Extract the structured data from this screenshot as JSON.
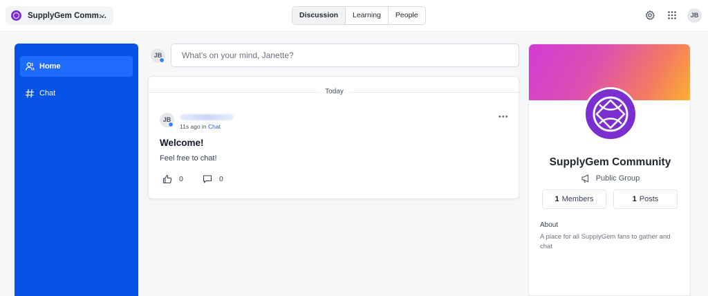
{
  "topbar": {
    "community_name": "SupplyGem Comm…",
    "tabs": [
      {
        "label": "Discussion",
        "active": true
      },
      {
        "label": "Learning",
        "active": false
      },
      {
        "label": "People",
        "active": false
      }
    ],
    "user_initials": "JB",
    "icons": [
      "gear-icon",
      "apps-grid-icon",
      "chevron-down-icon"
    ]
  },
  "sidebar": {
    "items": [
      {
        "label": "Home",
        "icon": "user-icon",
        "active": true
      },
      {
        "label": "Chat",
        "icon": "hashtag-icon",
        "active": false
      }
    ]
  },
  "composer": {
    "user_initials": "JB",
    "placeholder": "What's on your mind, Janette?"
  },
  "feed": {
    "day_label": "Today",
    "post": {
      "author_initials": "JB",
      "time": "11s ago",
      "in_label": "in",
      "channel": "Chat",
      "title": "Welcome!",
      "body": "Feel free to chat!",
      "likes": "0",
      "comments": "0"
    }
  },
  "community_panel": {
    "name": "SupplyGem Community",
    "type": "Public Group",
    "members_count": "1",
    "members_label": "Members",
    "posts_count": "1",
    "posts_label": "Posts",
    "about_heading": "About",
    "about_text": "A place for all SupplyGem fans to gather and chat"
  },
  "colors": {
    "sidebar_bg": "#0753e6",
    "sidebar_active": "#1e6bff",
    "brand_purple": "#7b2fd1",
    "link_blue": "#1d5fd8"
  }
}
